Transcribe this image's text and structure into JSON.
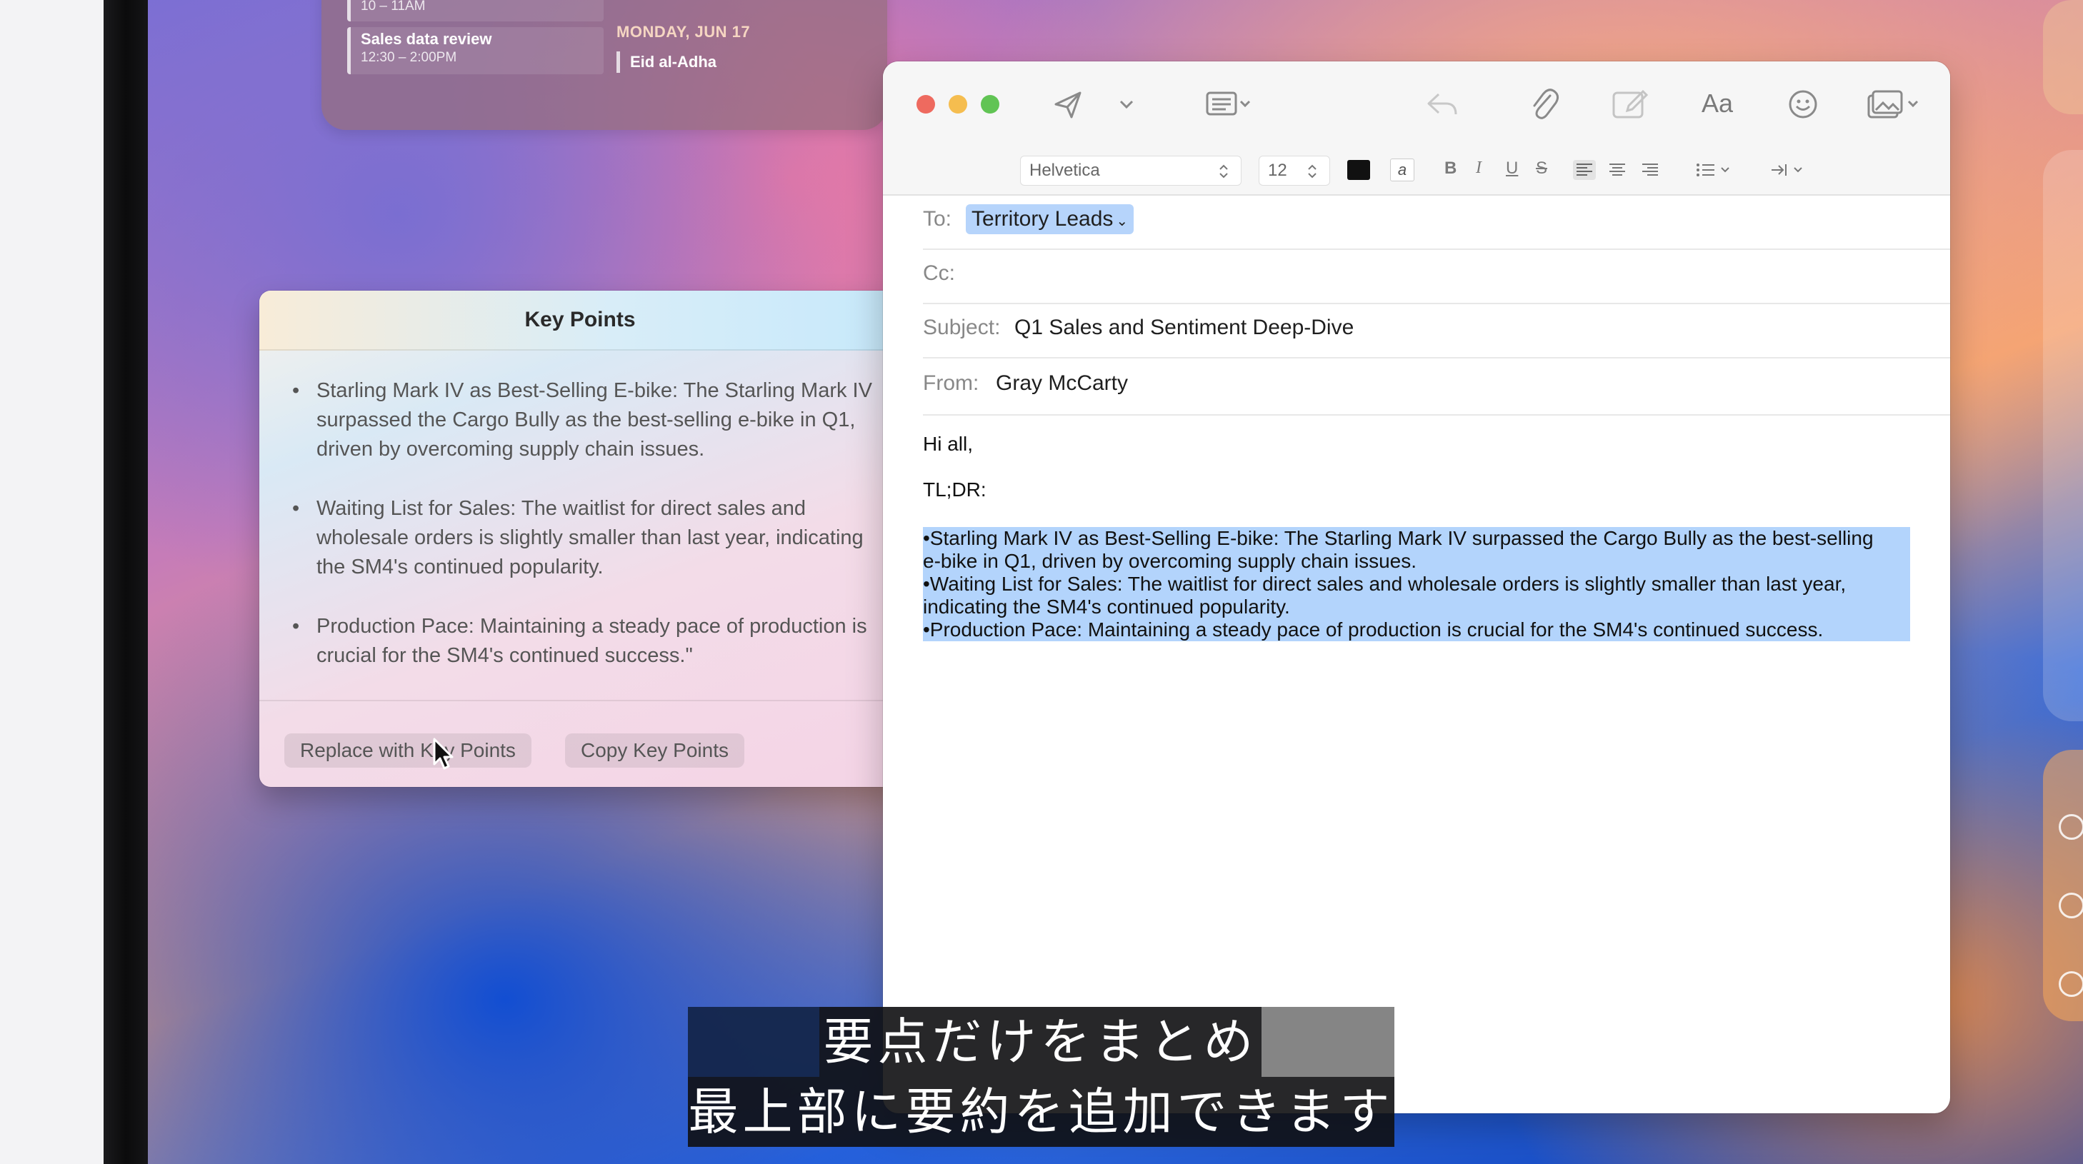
{
  "calendar": {
    "event1_time": "10 – 11AM",
    "event2_title": "Sales data review",
    "event2_time": "12:30 – 2:00PM",
    "date_header": "MONDAY, JUN 17",
    "holiday": "Eid al-Adha"
  },
  "key_points": {
    "title": "Key Points",
    "bullet_char": "•",
    "items": [
      "Starling Mark IV as Best-Selling E-bike: The Starling Mark IV surpassed the Cargo Bully as the best-selling e-bike in Q1, driven by overcoming supply chain issues.",
      "Waiting List for Sales: The waitlist for direct sales and wholesale orders is slightly smaller than last year, indicating the SM4's continued popularity.",
      "Production Pace: Maintaining a steady pace of production is crucial for the SM4's continued success.\""
    ],
    "replace_button": "Replace with Key Points",
    "copy_button": "Copy Key Points"
  },
  "mail": {
    "toolbar": {
      "send_icon": "paper-plane-icon",
      "header_fields_icon": "list-card-icon",
      "reply_icon": "reply-arrow-icon",
      "attach_icon": "paperclip-icon",
      "markup_icon": "compose-icon",
      "format_label": "Aa",
      "emoji_icon": "smiley-icon",
      "photo_icon": "photo-browser-icon"
    },
    "format_bar": {
      "font": "Helvetica",
      "size": "12",
      "bold": "B",
      "italic": "I",
      "underline": "U",
      "strike": "S"
    },
    "to_label": "To:",
    "to_value": "Territory Leads",
    "cc_label": "Cc:",
    "subject_label": "Subject:",
    "subject_value": "Q1 Sales and Sentiment Deep-Dive",
    "from_label": "From:",
    "from_value": "Gray McCarty",
    "body": {
      "greeting": "Hi all,",
      "tldr": "TL;DR:",
      "lines": [
        "•Starling Mark IV as Best-Selling E-bike: The Starling Mark IV surpassed the Cargo Bully as the best-selling",
        "e-bike in Q1, driven by overcoming supply chain issues.",
        "•Waiting List for Sales: The waitlist for direct sales and wholesale orders is slightly smaller than last year,",
        "indicating the SM4's continued popularity.",
        "•Production Pace: Maintaining a steady pace of production is crucial for the SM4's continued success."
      ]
    }
  },
  "subtitles": {
    "line1": "要点だけをまとめ",
    "line2": "最上部に要約を追加できます"
  },
  "colors": {
    "selection": "#b3d4fc",
    "to_token": "#b6d4fb",
    "close": "#ee6a5f",
    "minimize": "#f5bd4f",
    "zoom": "#61c454"
  }
}
